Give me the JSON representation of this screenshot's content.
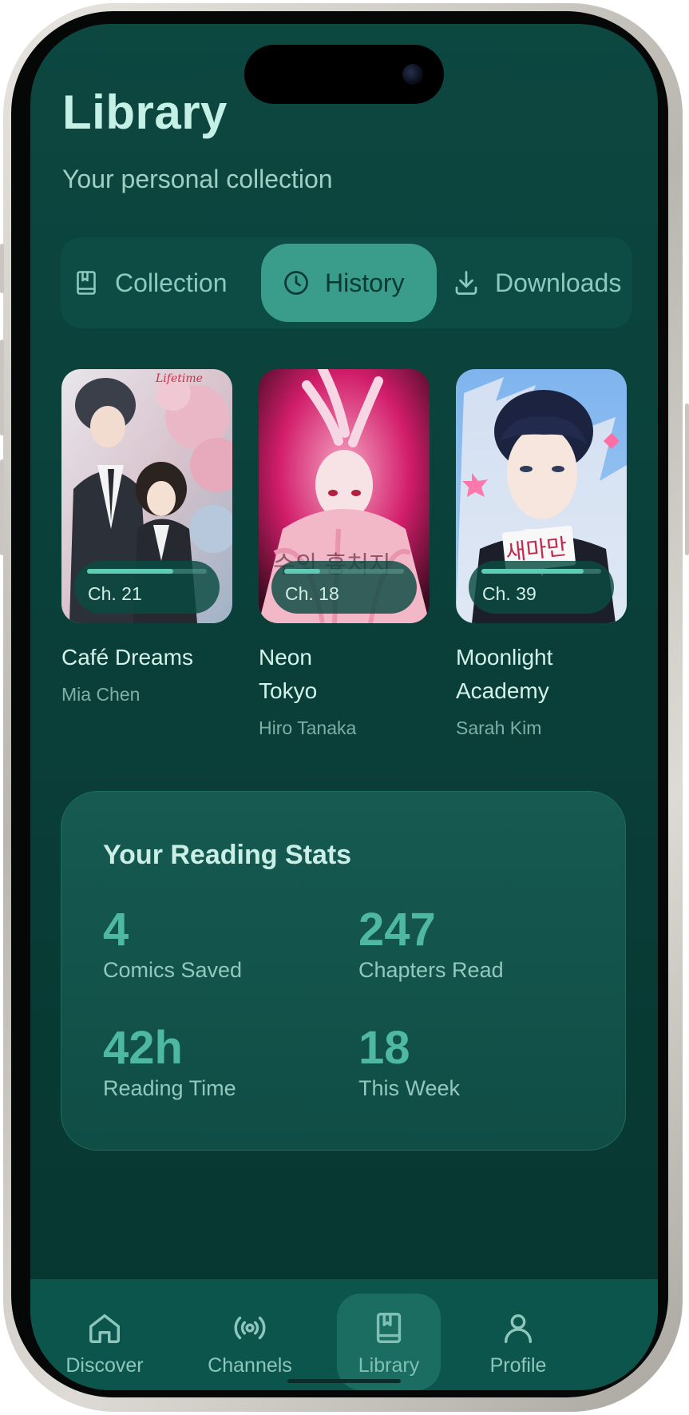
{
  "header": {
    "title": "Library",
    "subtitle": "Your personal collection"
  },
  "tabs": [
    {
      "label": "Collection",
      "icon": "book-icon",
      "active": false
    },
    {
      "label": "History",
      "icon": "clock-icon",
      "active": true
    },
    {
      "label": "Downloads",
      "icon": "download-icon",
      "active": false
    }
  ],
  "comics": [
    {
      "title": "Café Dreams",
      "author": "Mia Chen",
      "chapter": "Ch. 21",
      "progress": 0.72
    },
    {
      "title": "Neon\nTokyo",
      "author": "Hiro Tanaka",
      "chapter": "Ch. 18",
      "progress": 0.3
    },
    {
      "title": "Moonlight\nAcademy",
      "author": "Sarah Kim",
      "chapter": "Ch. 39",
      "progress": 0.85
    }
  ],
  "stats": {
    "title": "Your Reading Stats",
    "items": [
      {
        "value": "4",
        "label": "Comics Saved"
      },
      {
        "value": "247",
        "label": "Chapters Read"
      },
      {
        "value": "42h",
        "label": "Reading Time"
      },
      {
        "value": "18",
        "label": "This Week"
      }
    ]
  },
  "nav": [
    {
      "label": "Discover",
      "icon": "home-icon",
      "active": false
    },
    {
      "label": "Channels",
      "icon": "broadcast-icon",
      "active": false
    },
    {
      "label": "Library",
      "icon": "bookmark-book-icon",
      "active": true
    },
    {
      "label": "Profile",
      "icon": "user-icon",
      "active": false
    }
  ],
  "colors": {
    "accent": "#3a9d8b",
    "background": "#0a3f39",
    "stat_value": "#4fb8a3"
  }
}
